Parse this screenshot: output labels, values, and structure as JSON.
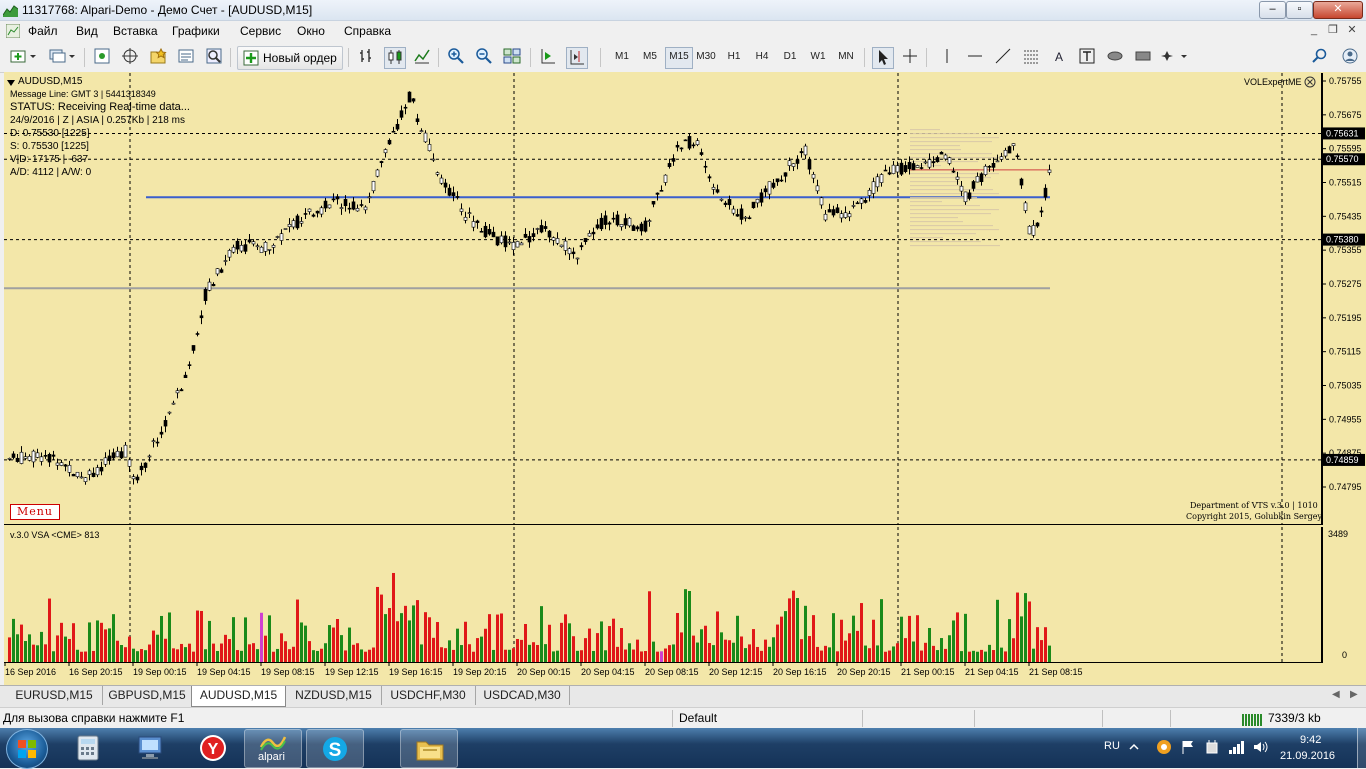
{
  "window": {
    "title": "11317768: Alpari-Demo - Демо Счет - [AUDUSD,M15]"
  },
  "menubar": {
    "items": [
      "Файл",
      "Вид",
      "Вставка",
      "Графики",
      "Сервис",
      "Окно",
      "Справка"
    ]
  },
  "toolbar": {
    "new_order_label": "Новый ордер",
    "timeframes": [
      "M1",
      "M5",
      "M15",
      "M30",
      "H1",
      "H4",
      "D1",
      "W1",
      "MN"
    ],
    "active_timeframe": "M15"
  },
  "chart": {
    "symbol_label": "AUDUSD,M15",
    "indicator_name": "VOLExpertME",
    "info_lines": [
      "Message Line: GMT 3 | 5441318349",
      "STATUS:  Receiving Real-time data...",
      "24/9/2016 | Z | ASIA | 0.257Kb | 218 ms",
      "D: 0.75530  [1225]",
      "S: 0.75530  [1225]",
      "V|D: 17175 | -637",
      "A/D: 4112 | A/W: 0"
    ],
    "menu_tag": "Menu",
    "copyright_1": "Department of VTS  v.3.0 | 1010",
    "copyright_2": "Copyright 2015, Golubkin Sergey",
    "price_ticks": [
      "0.75755",
      "0.75675",
      "0.75595",
      "0.75515",
      "0.75435",
      "0.75355",
      "0.75275",
      "0.75195",
      "0.75115",
      "0.75035",
      "0.74955",
      "0.74875",
      "0.74795"
    ],
    "highlighted_prices": [
      "0.75631",
      "0.75570",
      "0.75380",
      "0.74859"
    ],
    "volume_label": "v.3.0 VSA <CME> 813",
    "volume_scale_max": "3489",
    "volume_scale_min": "0",
    "time_labels": [
      "16 Sep 2016",
      "16 Sep 20:15",
      "19 Sep 00:15",
      "19 Sep 04:15",
      "19 Sep 08:15",
      "19 Sep 12:15",
      "19 Sep 16:15",
      "19 Sep 20:15",
      "20 Sep 00:15",
      "20 Sep 04:15",
      "20 Sep 08:15",
      "20 Sep 12:15",
      "20 Sep 16:15",
      "20 Sep 20:15",
      "21 Sep 00:15",
      "21 Sep 04:15",
      "21 Sep 08:15"
    ],
    "colors": {
      "background": "#f3e7a9",
      "candle": "#000000",
      "horizontal_line": "#3a5fcd",
      "volume_up": "#1a8a1a",
      "volume_down": "#e01818",
      "volume_special": "#d040d0"
    }
  },
  "tabs": [
    {
      "label": "EURUSD,M15",
      "active": false
    },
    {
      "label": "GBPUSD,M15",
      "active": false
    },
    {
      "label": "AUDUSD,M15",
      "active": true
    },
    {
      "label": "NZDUSD,M15",
      "active": false
    },
    {
      "label": "USDCHF,M30",
      "active": false
    },
    {
      "label": "USDCAD,M30",
      "active": false
    }
  ],
  "statusbar": {
    "help_text": "Для вызова справки нажмите F1",
    "profile": "Default",
    "traffic": "7339/3 kb"
  },
  "taskbar": {
    "pinned": [
      {
        "name": "calculator-icon"
      },
      {
        "name": "computer-icon"
      },
      {
        "name": "yandex-browser-icon"
      },
      {
        "name": "alpari-terminal-icon",
        "label": "alpari"
      },
      {
        "name": "skype-icon"
      },
      {
        "name": "explorer-folder-icon"
      }
    ],
    "language": "RU",
    "time": "9:42",
    "date": "21.09.2016"
  }
}
